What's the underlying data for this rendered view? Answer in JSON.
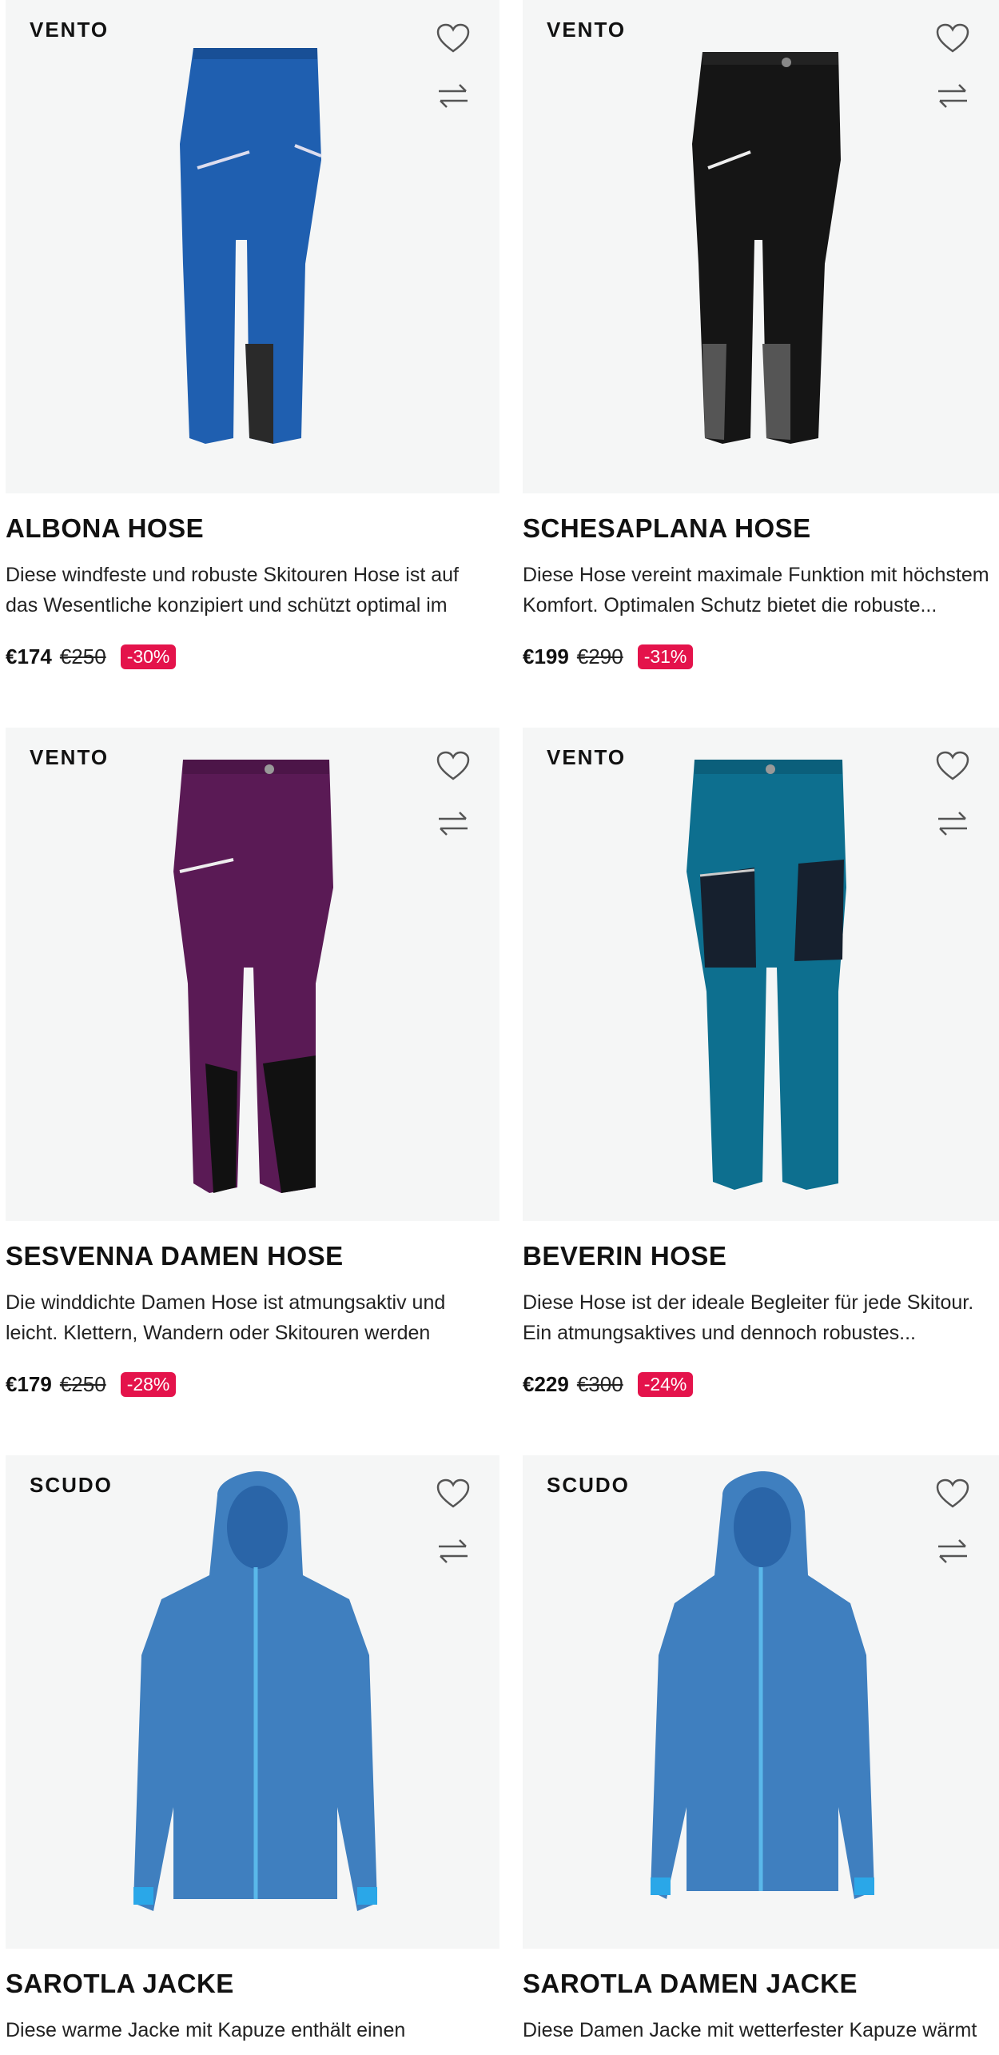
{
  "products": [
    {
      "brand": "VENTO",
      "title": "ALBONA HOSE",
      "description": "Diese windfeste und robuste Skitouren Hose ist auf das Wesentliche konzipiert und schützt optimal im Gebirg...",
      "price": "€174",
      "old_price": "€250",
      "discount": "-30%",
      "image": "blue-pants",
      "color": "#1f5fb0"
    },
    {
      "brand": "VENTO",
      "title": "SCHESAPLANA HOSE",
      "description": "Diese Hose vereint maximale Funktion mit höchstem Komfort. Optimalen Schutz bietet die robuste...",
      "price": "€199",
      "old_price": "€290",
      "discount": "-31%",
      "image": "black-pants",
      "color": "#151515"
    },
    {
      "brand": "VENTO",
      "title": "SESVENNA DAMEN HOSE",
      "description": "Die winddichte Damen Hose ist atmungsaktiv und leicht. Klettern, Wandern oder Skitouren werden dank...",
      "price": "€179",
      "old_price": "€250",
      "discount": "-28%",
      "image": "purple-pants",
      "color": "#5a1a55"
    },
    {
      "brand": "VENTO",
      "title": "BEVERIN HOSE",
      "description": "Diese Hose ist der ideale Begleiter für jede Skitour. Ein atmungsaktives und dennoch robustes...",
      "price": "€229",
      "old_price": "€300",
      "discount": "-24%",
      "image": "teal-pants",
      "color": "#0d6f8f"
    },
    {
      "brand": "SCUDO",
      "title": "SAROTLA JACKE",
      "description": "Diese warme Jacke mit Kapuze enthält einen",
      "image": "blue-jacket",
      "color": "#3f7fbf"
    },
    {
      "brand": "SCUDO",
      "title": "SAROTLA DAMEN JACKE",
      "description": "Diese Damen Jacke mit wetterfester Kapuze wärmt",
      "image": "blue-jacket-women",
      "color": "#3f7fbf"
    }
  ],
  "colors": {
    "badge": "#e4134b",
    "media_bg": "#f5f6f6"
  }
}
